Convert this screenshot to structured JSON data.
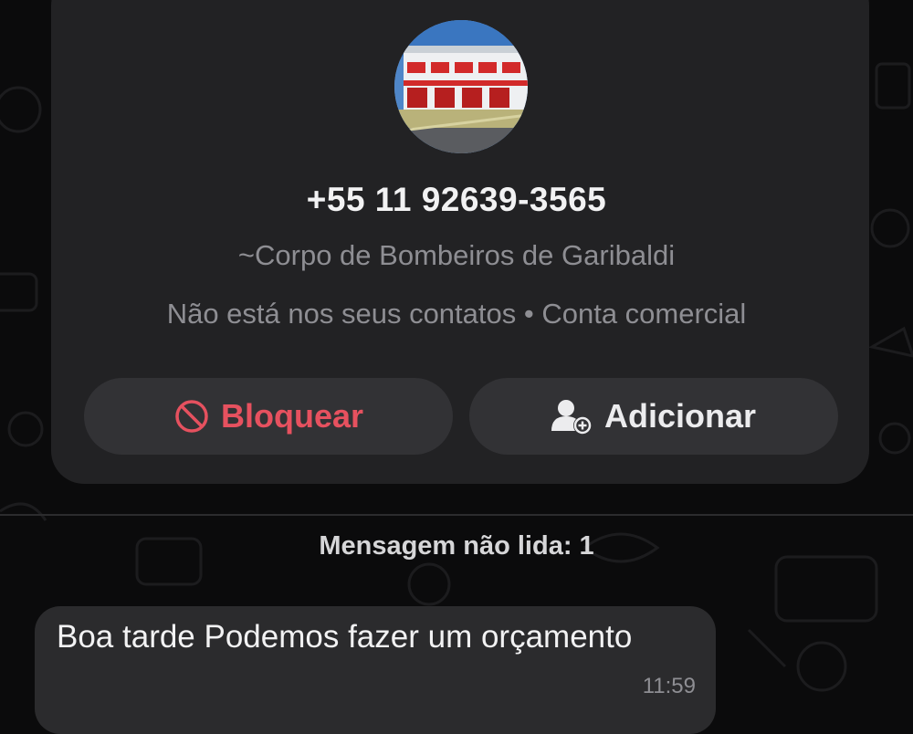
{
  "contact": {
    "phone": "+55 11 92639-3565",
    "profile_name": "~Corpo de Bombeiros de Garibaldi",
    "status": "Não está nos seus contatos • Conta comercial"
  },
  "actions": {
    "block_label": "Bloquear",
    "add_label": "Adicionar"
  },
  "chat": {
    "unread_label": "Mensagem não lida: 1",
    "messages": [
      {
        "text": "Boa tarde Podemos fazer um orçamento",
        "time": "11:59"
      }
    ]
  },
  "colors": {
    "danger": "#e6515f",
    "card": "#222224",
    "button": "#323235",
    "bubble": "#2b2b2d",
    "muted_text": "#8e8e93"
  },
  "icons": {
    "block": "block-icon",
    "add_contact": "add-contact-icon"
  }
}
